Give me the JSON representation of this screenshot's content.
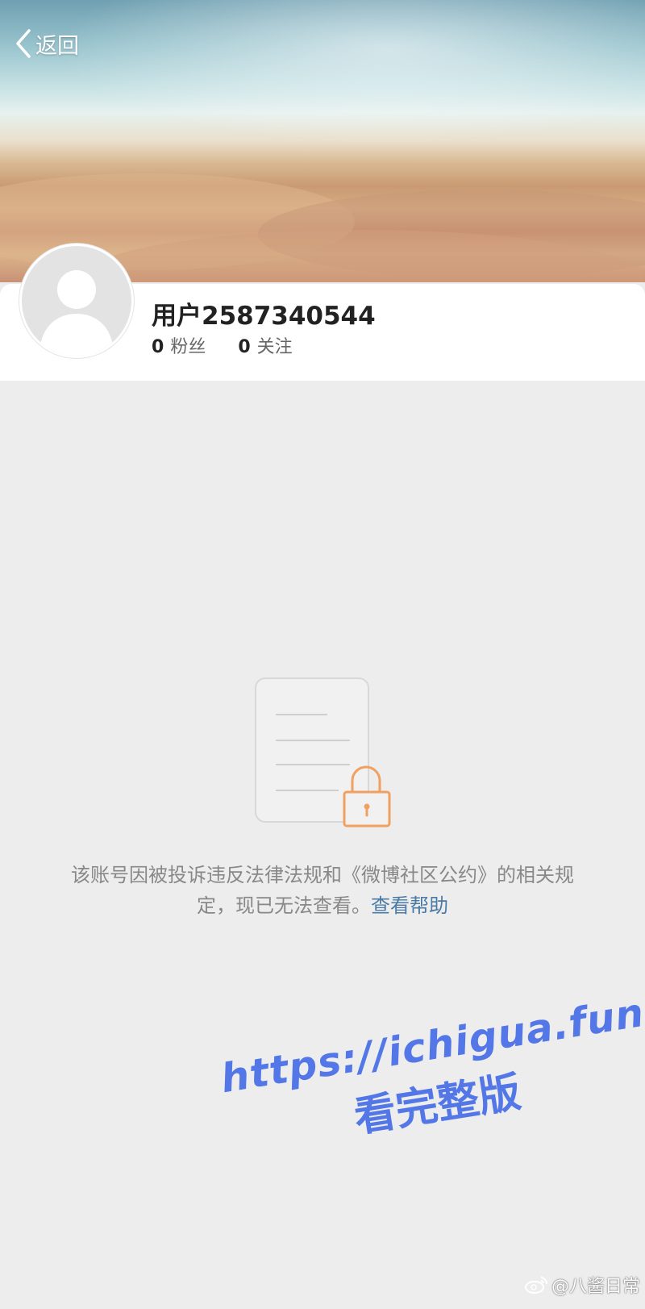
{
  "header": {
    "back_label": "返回"
  },
  "profile": {
    "username": "用户2587340544",
    "fans_count": "0",
    "fans_label": "粉丝",
    "following_count": "0",
    "following_label": "关注"
  },
  "notice": {
    "message": "该账号因被投诉违反法律法规和《微博社区公约》的相关规定，现已无法查看。",
    "help_link": "查看帮助"
  },
  "watermark": {
    "url": "https://ichigua.fun",
    "subtitle": "看完整版"
  },
  "credit": {
    "text": "@八酱日常"
  },
  "colors": {
    "page_background": "#ededed",
    "link": "#4a7aa6",
    "lock_orange": "#f0a060",
    "watermark_blue": "#5477e8"
  },
  "icons": {
    "back": "chevron-left-icon",
    "avatar": "default-avatar-icon",
    "illustration": "document-lock-icon",
    "credit": "weibo-icon"
  }
}
